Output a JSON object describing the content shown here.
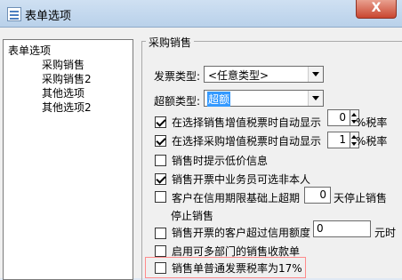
{
  "window": {
    "title": "表单选项",
    "close_symbol": "X"
  },
  "tree": {
    "root": "表单选项",
    "items": [
      "采购销售",
      "采购销售2",
      "其他选项",
      "其他选项2"
    ]
  },
  "section": {
    "title": "采购销售"
  },
  "invoice_type": {
    "label": "发票类型:",
    "value": "<任意类型>"
  },
  "overage_type": {
    "label": "超额类型:",
    "value": "超额"
  },
  "options": {
    "sales_tax_auto": {
      "label": "在选择销售增值税票时自动显示",
      "value": "0",
      "suffix": "%税率",
      "checked": true
    },
    "purchase_tax_auto": {
      "label": "在选择采购增值税票时自动显示",
      "value": "1",
      "suffix": "%税率",
      "checked": true
    },
    "low_price_prompt": {
      "label": "销售时提示低价信息",
      "checked": false
    },
    "sales_staff_non_self": {
      "label": "销售开票中业务员可选非本人",
      "checked": true
    },
    "credit_overdue_stop": {
      "label_1": "客户在信用期限基础上超期",
      "value": "0",
      "label_2": "天停止销售",
      "label_3": "停止销售",
      "checked": false
    },
    "credit_amount_over": {
      "label": "销售开票的客户超过信用额度",
      "value": "0",
      "suffix": "元时",
      "checked": false
    },
    "multi_department": {
      "label": "启用可多部门的销售收款单",
      "checked": false
    },
    "ordinary_invoice_rate": {
      "label": "销售单普通发票税率为17%",
      "checked": false
    }
  }
}
